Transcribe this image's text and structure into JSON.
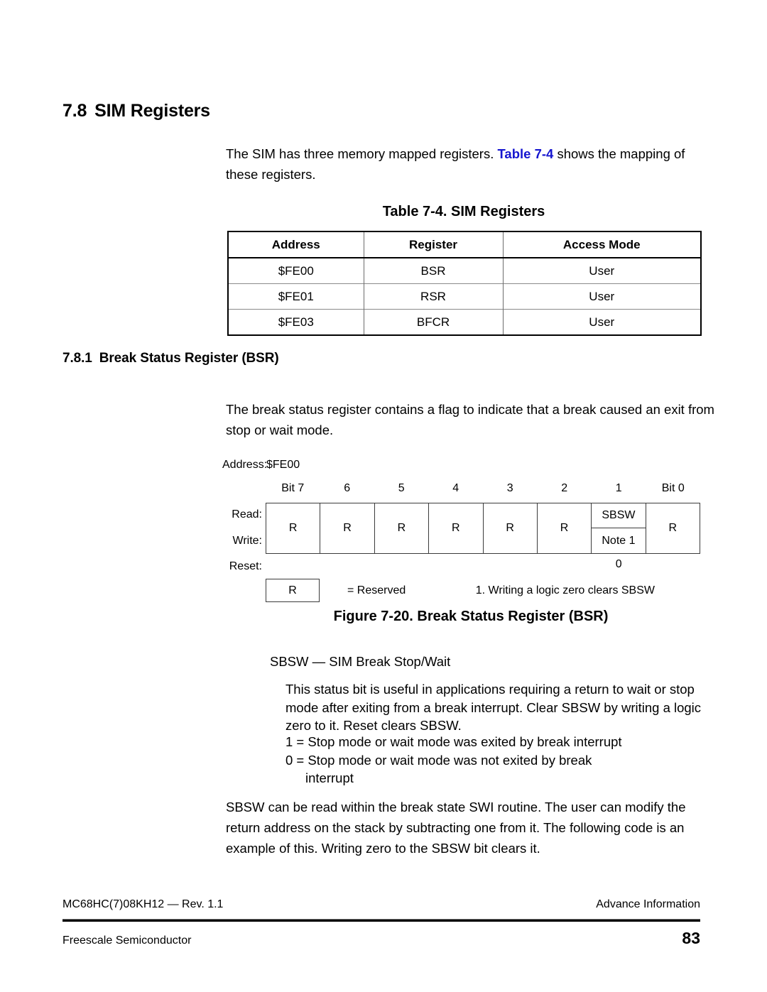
{
  "section": {
    "number": "7.8",
    "title": "SIM Registers",
    "intro_before_link": "The SIM has three memory mapped registers. ",
    "intro_link": "Table 7-4",
    "intro_after_link": " shows the mapping of these registers."
  },
  "table": {
    "caption": "Table 7-4. SIM Registers",
    "headers": [
      "Address",
      "Register",
      "Access Mode"
    ],
    "rows": [
      [
        "$FE00",
        "BSR",
        "User"
      ],
      [
        "$FE01",
        "RSR",
        "User"
      ],
      [
        "$FE03",
        "BFCR",
        "User"
      ]
    ]
  },
  "subsection": {
    "number": "7.8.1",
    "title": "Break Status Register (BSR)",
    "paragraph": "The break status register contains a flag to indicate that a break caused an exit from stop or wait mode."
  },
  "register_diagram": {
    "address_label": "Address:",
    "address_value": "$FE00",
    "bit_labels": [
      "Bit 7",
      "6",
      "5",
      "4",
      "3",
      "2",
      "1",
      "Bit 0"
    ],
    "row_labels": {
      "read": "Read:",
      "write": "Write:",
      "reset": "Reset:"
    },
    "cells": [
      {
        "type": "full",
        "text": "R"
      },
      {
        "type": "full",
        "text": "R"
      },
      {
        "type": "full",
        "text": "R"
      },
      {
        "type": "full",
        "text": "R"
      },
      {
        "type": "full",
        "text": "R"
      },
      {
        "type": "full",
        "text": "R"
      },
      {
        "type": "split",
        "read": "SBSW",
        "write": "Note 1"
      },
      {
        "type": "full",
        "text": "R"
      }
    ],
    "reset_values": [
      "",
      "",
      "",
      "",
      "",
      "",
      "0",
      ""
    ],
    "legend_symbol": "R",
    "legend_text": "= Reserved",
    "legend_note": "1. Writing a logic zero clears SBSW",
    "figure_caption": "Figure 7-20. Break Status Register (BSR)"
  },
  "sbsw": {
    "title": "SBSW — SIM Break Stop/Wait",
    "body": "This status bit is useful in applications requiring a return to wait or stop mode after exiting from a break interrupt. Clear SBSW by writing a logic zero to it. Reset clears SBSW.",
    "bit_one": "1 = Stop mode or wait mode was exited by break interrupt",
    "bit_zero": "0 = Stop mode or wait mode was not exited by break",
    "bit_zero_cont": "interrupt"
  },
  "closing_paragraph": "SBSW can be read within the break state SWI routine. The user can modify the return address on the stack by subtracting one from it. The following code is an example of this. Writing zero to the SBSW bit clears it.",
  "footer": {
    "document_id": "MC68HC(7)08KH12 — Rev. 1.1",
    "status": "Advance Information",
    "company": "Freescale Semiconductor",
    "page_number": "83"
  },
  "colors": {
    "link": "#1515cf",
    "text": "#000000",
    "rule": "#3b3b3b"
  }
}
